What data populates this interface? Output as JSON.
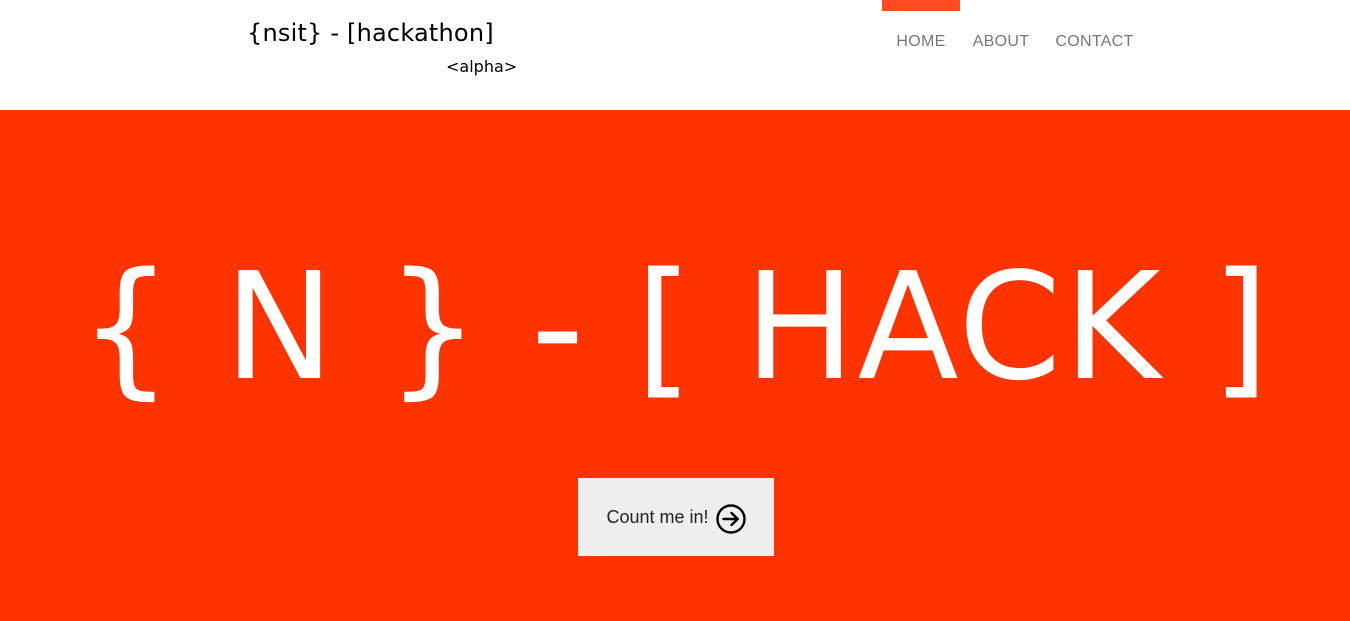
{
  "brand": {
    "title": "{nsit} - [hackathon]",
    "subtitle": "<alpha>"
  },
  "nav": {
    "items": [
      {
        "label": "HOME",
        "active": true
      },
      {
        "label": "ABOUT",
        "active": false
      },
      {
        "label": "CONTACT",
        "active": false
      }
    ]
  },
  "hero": {
    "title": "{ N } - [ HACK ]",
    "cta_label": "Count me in!",
    "cta_icon": "circle-arrow-right-icon"
  },
  "colors": {
    "accent": "#ff3300",
    "nav_active_bar": "#ff4a22",
    "nav_text": "#777777",
    "button_bg": "#eeeeee"
  }
}
